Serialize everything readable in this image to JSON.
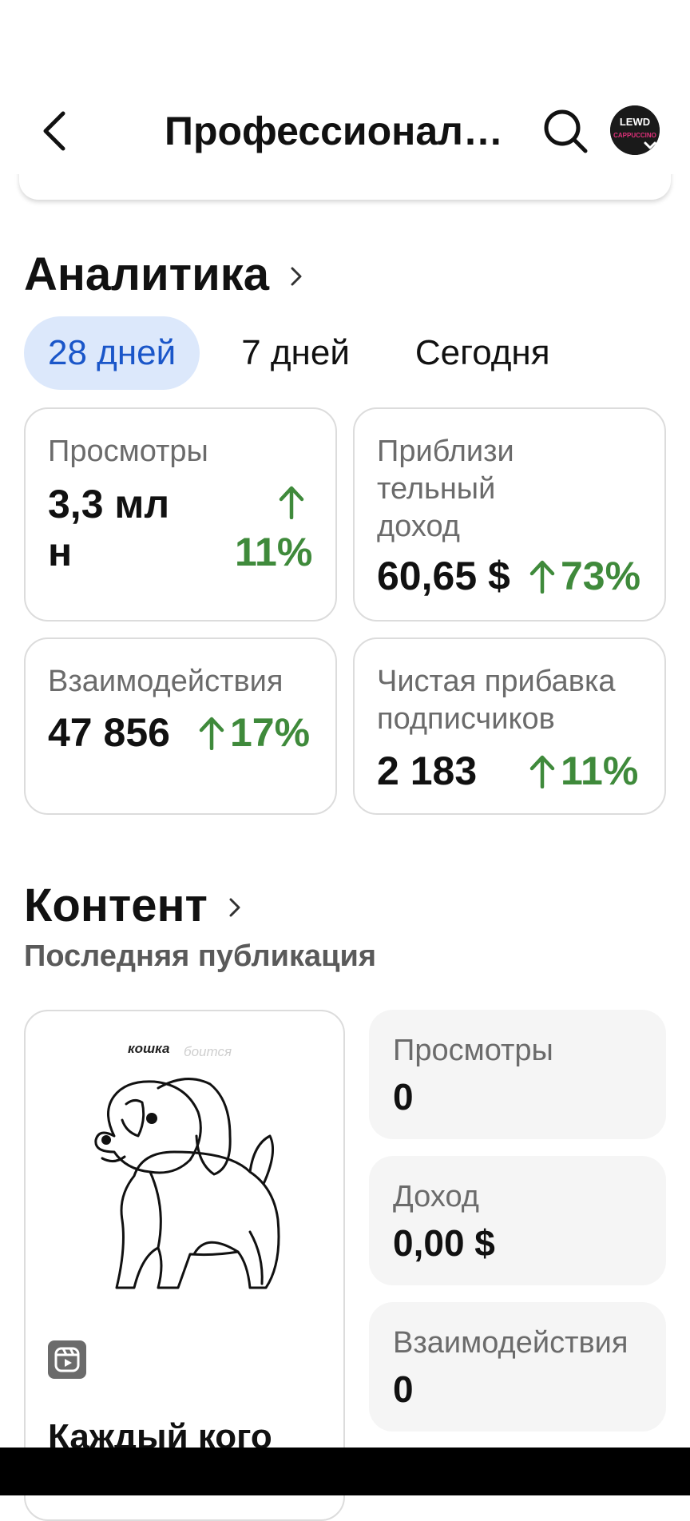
{
  "header": {
    "title": "Профессиональ…",
    "avatar_text_top": "LEWD",
    "avatar_text_bottom": "CAPPUCCINO"
  },
  "analytics": {
    "title": "Аналитика",
    "tabs": [
      {
        "label": "28 дней",
        "active": true
      },
      {
        "label": "7 дней",
        "active": false
      },
      {
        "label": "Сегодня",
        "active": false
      }
    ],
    "cards": [
      {
        "label": "Просмотры",
        "value_line1": "3,3 мл",
        "value_line2": "н",
        "change": "11%"
      },
      {
        "label_line1": "Приблизи",
        "label_line2": "тельный",
        "label_line3": "доход",
        "value": "60,65 $",
        "change": "73%"
      },
      {
        "label": "Взаимодействия",
        "value": "47 856",
        "change": "17%"
      },
      {
        "label_line1": "Чистая прибавка",
        "label_line2": "подписчиков",
        "value": "2 183",
        "change": "11%"
      }
    ]
  },
  "content": {
    "title": "Контент",
    "subtitle": "Последняя публикация",
    "post": {
      "image_text_1": "кошка",
      "image_text_2": "боится",
      "caption": "Каждый кого"
    },
    "metrics": [
      {
        "label": "Просмотры",
        "value": "0"
      },
      {
        "label": "Доход",
        "value": "0,00 $"
      },
      {
        "label": "Взаимодействия",
        "value": "0"
      }
    ]
  },
  "colors": {
    "accent_blue": "#1a56c9",
    "active_tab_bg": "#dce8fb",
    "positive_green": "#3f8a3b"
  },
  "icons": [
    "back-arrow-icon",
    "search-icon",
    "chevron-right-icon",
    "arrow-up-icon",
    "reels-icon",
    "chevron-down-icon"
  ]
}
